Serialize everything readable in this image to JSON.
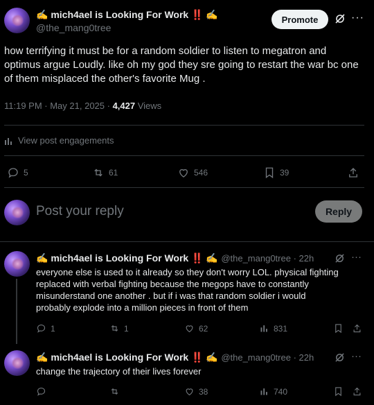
{
  "main_post": {
    "author_name": "✍️ mich4ael is Looking For Work ‼️ ✍️",
    "author_handle": "@the_mang0tree",
    "promote_label": "Promote",
    "text": "how terrifying it must be for a random soldier to listen to megatron and optimus argue Loudly. like  oh my god they sre going to restart the war bc one of them misplaced the other's favorite Mug .",
    "time": "11:19 PM · May 21, 2025 · ",
    "views_count": "4,427",
    "views_label": " Views",
    "engagements_label": "View post engagements",
    "replies": "5",
    "reposts": "61",
    "likes": "546",
    "bookmarks": "39"
  },
  "compose": {
    "placeholder": "Post your reply",
    "button": "Reply"
  },
  "replies": [
    {
      "author_name": "✍️ mich4ael is Looking For Work ‼️ ✍️",
      "author_handle": "@the_mang0tree",
      "time": " · 22h",
      "text": "everyone else is used to it already so they don't worry LOL. physical fighting replaced with verbal fighting because the megops have to constantly misunderstand one another . but if i was that random soldier i would probably explode into a million pieces in front of them",
      "replies": "1",
      "reposts": "1",
      "likes": "62",
      "views": "831"
    },
    {
      "author_name": "✍️ mich4ael is Looking For Work ‼️ ✍️",
      "author_handle": "@the_mang0tree",
      "time": " · 22h",
      "text": "change the trajectory of their lives forever",
      "replies": "",
      "reposts": "",
      "likes": "38",
      "views": "740"
    }
  ]
}
